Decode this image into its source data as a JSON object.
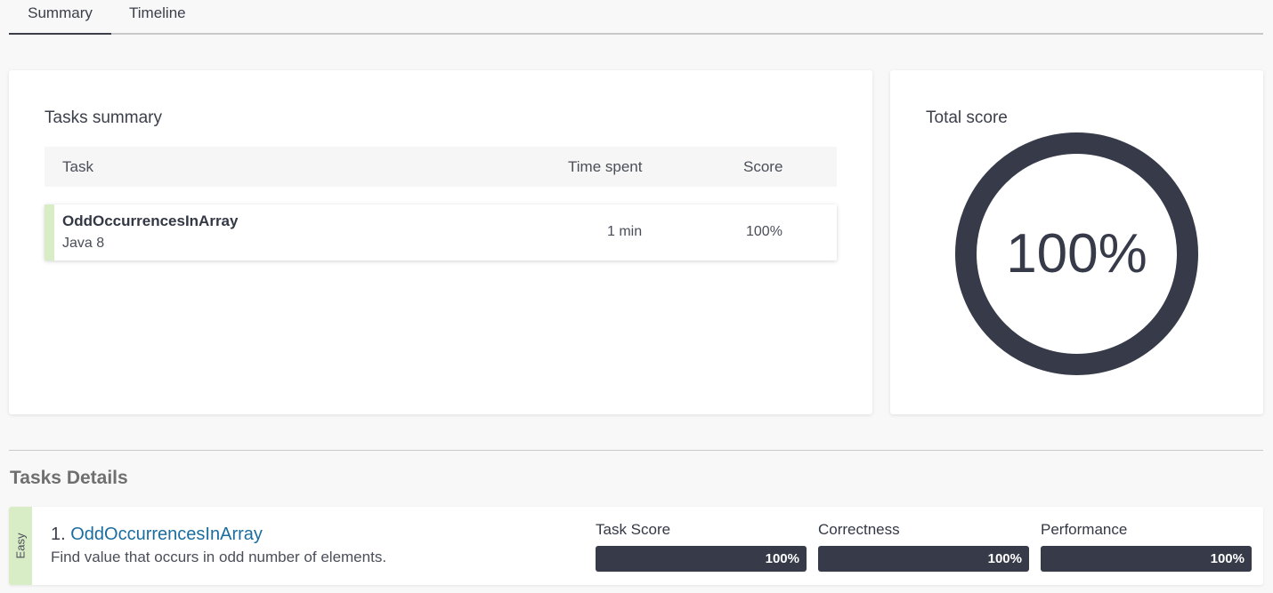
{
  "tabs": [
    {
      "label": "Summary",
      "active": true
    },
    {
      "label": "Timeline",
      "active": false
    }
  ],
  "tasks_summary": {
    "title": "Tasks summary",
    "columns": [
      "Task",
      "Time spent",
      "Score"
    ],
    "rows": [
      {
        "name": "OddOccurrencesInArray",
        "language": "Java 8",
        "time_spent": "1 min",
        "score": "100%"
      }
    ]
  },
  "total_score": {
    "title": "Total score",
    "value": "100%",
    "fraction": 1.0
  },
  "tasks_details": {
    "title": "Tasks Details",
    "items": [
      {
        "difficulty": "Easy",
        "number": "1.",
        "name": "OddOccurrencesInArray",
        "description": "Find value that occurs in odd number of elements.",
        "metrics": [
          {
            "label": "Task Score",
            "value": "100%",
            "fraction": 1.0
          },
          {
            "label": "Correctness",
            "value": "100%",
            "fraction": 1.0
          },
          {
            "label": "Performance",
            "value": "100%",
            "fraction": 1.0
          }
        ]
      }
    ]
  },
  "colors": {
    "accent_green": "#d8ecc6",
    "dark": "#363a49",
    "link": "#1a6d9e"
  }
}
